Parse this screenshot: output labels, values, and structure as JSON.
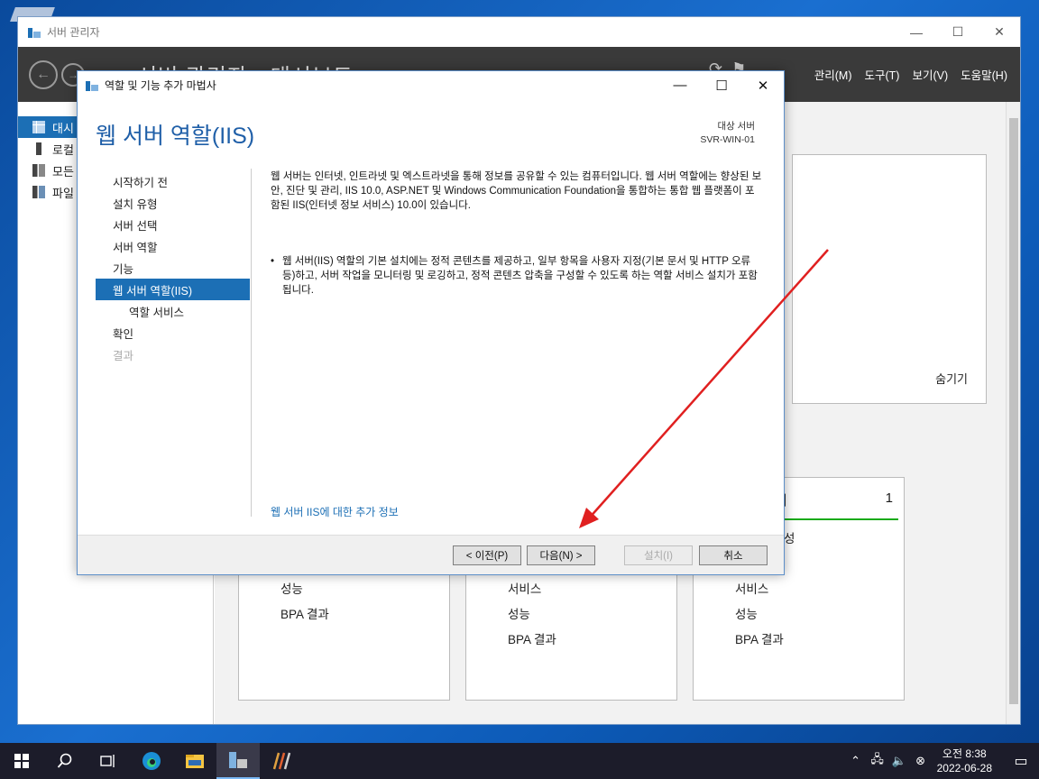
{
  "server_manager": {
    "title": "서버 관리자",
    "header_title": "서버 관리자 • 대시보드",
    "menus": [
      "관리(M)",
      "도구(T)",
      "보기(V)",
      "도움말(H)"
    ],
    "sidebar": [
      {
        "label": "대시",
        "icon": "dashboard-icon"
      },
      {
        "label": "로컬",
        "icon": "local-server-icon"
      },
      {
        "label": "모든",
        "icon": "all-servers-icon"
      },
      {
        "label": "파일",
        "icon": "file-services-icon"
      }
    ],
    "hide_label": "숨기기",
    "tiles": [
      {
        "rows": [
          "성능",
          "BPA 결과"
        ]
      },
      {
        "rows": [
          "서비스",
          "성능",
          "BPA 결과"
        ]
      },
      {
        "title": "버",
        "count": "1",
        "rows": [
          "성",
          "서비스",
          "성능",
          "BPA 결과"
        ]
      }
    ]
  },
  "wizard": {
    "title": "역할 및 기능 추가 마법사",
    "heading": "웹 서버 역할(IIS)",
    "target_label": "대상 서버",
    "target_server": "SVR-WIN-01",
    "steps": [
      {
        "label": "시작하기 전",
        "state": "normal"
      },
      {
        "label": "설치 유형",
        "state": "normal"
      },
      {
        "label": "서버 선택",
        "state": "normal"
      },
      {
        "label": "서버 역할",
        "state": "normal"
      },
      {
        "label": "기능",
        "state": "normal"
      },
      {
        "label": "웹 서버 역할(IIS)",
        "state": "active"
      },
      {
        "label": "역할 서비스",
        "state": "sub"
      },
      {
        "label": "확인",
        "state": "normal"
      },
      {
        "label": "결과",
        "state": "disabled"
      }
    ],
    "description": "웹 서버는 인터넷, 인트라넷 및 엑스트라넷을 통해 정보를 공유할 수 있는 컴퓨터입니다. 웹 서버 역할에는 향상된 보안, 진단 및 관리, IIS 10.0, ASP.NET 및 Windows Communication Foundation을 통합하는 통합 웹 플랫폼이 포함된 IIS(인터넷 정보 서비스) 10.0이 있습니다.",
    "bullet": "웹 서버(IIS) 역할의 기본 설치에는 정적 콘텐츠를 제공하고, 일부 항목을 사용자 지정(기본 문서 및 HTTP 오류 등)하고, 서버 작업을 모니터링 및 로깅하고, 정적 콘텐츠 압축을 구성할 수 있도록 하는 역할 서비스 설치가 포함됩니다.",
    "more_info_link": "웹 서버 IIS에 대한 추가 정보",
    "buttons": {
      "prev": "< 이전(P)",
      "next": "다음(N) >",
      "install": "설치(I)",
      "cancel": "취소"
    }
  },
  "taskbar": {
    "clock_time": "오전 8:38",
    "clock_date": "2022-06-28"
  },
  "colors": {
    "accent": "#1c6fb5",
    "header_dark": "#3a3a3a",
    "annotation_arrow": "#e02020"
  }
}
